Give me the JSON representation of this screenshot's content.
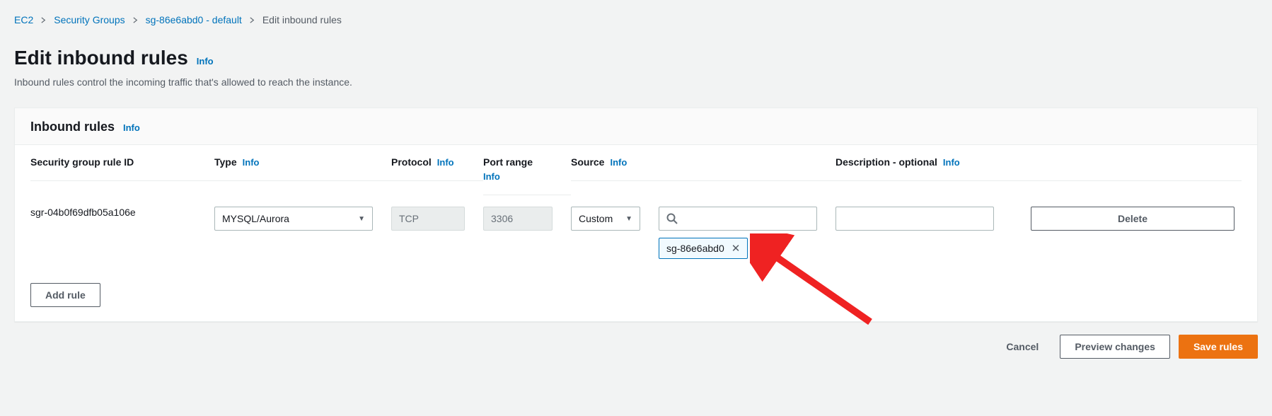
{
  "breadcrumb": {
    "items": [
      "EC2",
      "Security Groups",
      "sg-86e6abd0 - default"
    ],
    "current": "Edit inbound rules"
  },
  "header": {
    "title": "Edit inbound rules",
    "info_label": "Info",
    "description": "Inbound rules control the incoming traffic that's allowed to reach the instance."
  },
  "panel": {
    "title": "Inbound rules",
    "info_label": "Info",
    "columns": {
      "sg_rule_id": "Security group rule ID",
      "type": "Type",
      "protocol": "Protocol",
      "port_range": "Port range",
      "source": "Source",
      "description": "Description - optional"
    },
    "rules": [
      {
        "id": "sgr-04b0f69dfb05a106e",
        "type": "MYSQL/Aurora",
        "protocol": "TCP",
        "port_range": "3306",
        "source_mode": "Custom",
        "source_search": "",
        "source_tag": "sg-86e6abd0",
        "description": ""
      }
    ],
    "add_rule_label": "Add rule",
    "delete_label": "Delete"
  },
  "footer": {
    "cancel": "Cancel",
    "preview": "Preview changes",
    "save": "Save rules"
  }
}
